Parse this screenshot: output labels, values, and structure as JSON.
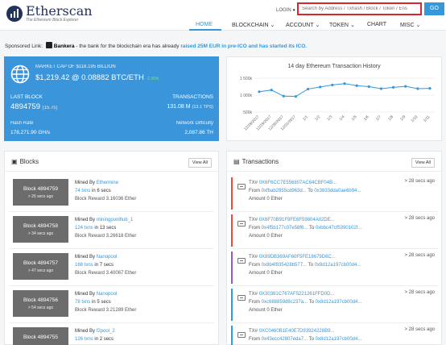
{
  "header": {
    "logo_name": "Etherscan",
    "logo_tag": "The Ethereum Block Explorer",
    "login": "LOGIN",
    "search_placeholder": "Search by Address / Txhash / Block / Token / Ens",
    "go": "GO",
    "nav": [
      "HOME",
      "BLOCKCHAIN",
      "ACCOUNT",
      "TOKEN",
      "CHART",
      "MISC"
    ]
  },
  "sponsored": {
    "prefix": "Sponsored Link:",
    "name": "Bankera",
    "text": " - the bank for the blockchain era has already ",
    "highlight": "raised 25M EUR in pre-ICO and has started its ICO."
  },
  "market": {
    "mcap_label": "MARKET CAP OF $118.195 BILLION",
    "mcap_value": "$1,219.42 @ 0.08882 BTC/ETH",
    "mcap_change": "-2.36%",
    "last_block_label": "LAST BLOCK",
    "last_block_value": "4894759",
    "last_block_rate": "(15.7s)",
    "tx_label": "TRANSACTIONS",
    "tx_value": "131.08 M",
    "tx_rate": "(13.1 TPS)",
    "hashrate_label": "Hash Rate",
    "hashrate_value": "178,271.90 GH/s",
    "difficulty_label": "Network Difficulty",
    "difficulty_value": "2,087.86 TH"
  },
  "chart_data": {
    "type": "line",
    "title": "14 day Ethereum Transaction History",
    "x": [
      "12/28/2017",
      "12/29/2017",
      "12/30/2017",
      "12/31/2017",
      "1/1",
      "1/2",
      "1/3",
      "1/4",
      "1/5",
      "1/6",
      "1/7",
      "1/8",
      "1/9",
      "1/10",
      "1/11"
    ],
    "values": [
      1100000,
      1150000,
      970000,
      960000,
      1180000,
      1240000,
      1300000,
      1340000,
      1280000,
      1250000,
      1190000,
      1230000,
      1260000,
      1190000,
      1200000
    ],
    "yticks": [
      "1 500k",
      "1 000k",
      "500k"
    ],
    "ylim": [
      500000,
      1500000
    ],
    "color": "#3498db"
  },
  "blocks": {
    "title": "Blocks",
    "view_all": "View All",
    "items": [
      {
        "number": "Block 4894759",
        "age": "> 26 secs ago",
        "miner_prefix": "Mined By",
        "miner": "Ethermine",
        "txns": "74 txns",
        "time": "in 6 secs",
        "reward": "Block Reward 3.16036 Ether"
      },
      {
        "number": "Block 4894758",
        "age": "> 34 secs ago",
        "miner_prefix": "Mined By",
        "miner": "miningpoolhub_1",
        "txns": "124 txns",
        "time": "in 13 secs",
        "reward": "Block Reward 3.26618 Ether"
      },
      {
        "number": "Block 4894757",
        "age": "> 47 secs ago",
        "miner_prefix": "Mined By",
        "miner": "Nanopool",
        "txns": "168 txns",
        "time": "in 7 secs",
        "reward": "Block Reward 3.40067 Ether"
      },
      {
        "number": "Block 4894756",
        "age": "> 54 secs ago",
        "miner_prefix": "Mined By",
        "miner": "Nanopool",
        "txns": "78 txns",
        "time": "in 5 secs",
        "reward": "Block Reward 3.21289 Ether"
      },
      {
        "number": "Block 4894755",
        "age": "",
        "miner_prefix": "Mined By",
        "miner": "f2pool_2",
        "txns": "126 txns",
        "time": "in 2 secs",
        "reward": ""
      }
    ]
  },
  "transactions": {
    "title": "Transactions",
    "view_all": "View All",
    "items": [
      {
        "hash": "0X6F6CC7E556807AC64CBF04B...",
        "from": "0xfbab2855cd963d...",
        "to": "0x3833dda0ae6b94...",
        "amount": "Amount 0 Ether",
        "age": "> 28 secs ago",
        "accent": "#e74c3c"
      },
      {
        "hash": "0X6F70B91F9FE6F59804A02DE...",
        "from": "0x4f5b177c07e58f6...",
        "to": "0xbbc47cf5390102f...",
        "amount": "Amount 0 Ether",
        "age": "> 28 secs ago",
        "accent": "#e74c3c"
      },
      {
        "hash": "0X89DB369AF60F5FE18679D6C...",
        "from": "0x8b4f835428b577...",
        "to": "0x8d12a197cb00d4...",
        "amount": "Amount 0 Ether",
        "age": "> 28 secs ago",
        "accent": "#9b59b6"
      },
      {
        "hash": "0X30381C767AF5221261FFD0D...",
        "from": "0xc688859d8c237a...",
        "to": "0x8d12a197cb00d4...",
        "amount": "Amount 0 Ether",
        "age": "> 28 secs ago",
        "accent": "#3498db"
      },
      {
        "hash": "0XC0460B1E40E7D93924228B9...",
        "from": "0x43ecc42807eda7...",
        "to": "0x8d12a197cb00d4...",
        "amount": "",
        "age": "> 28 secs ago",
        "accent": "#3498db"
      }
    ]
  },
  "labels": {
    "tx_prefix": "TX#",
    "from": "From",
    "to": "To"
  }
}
